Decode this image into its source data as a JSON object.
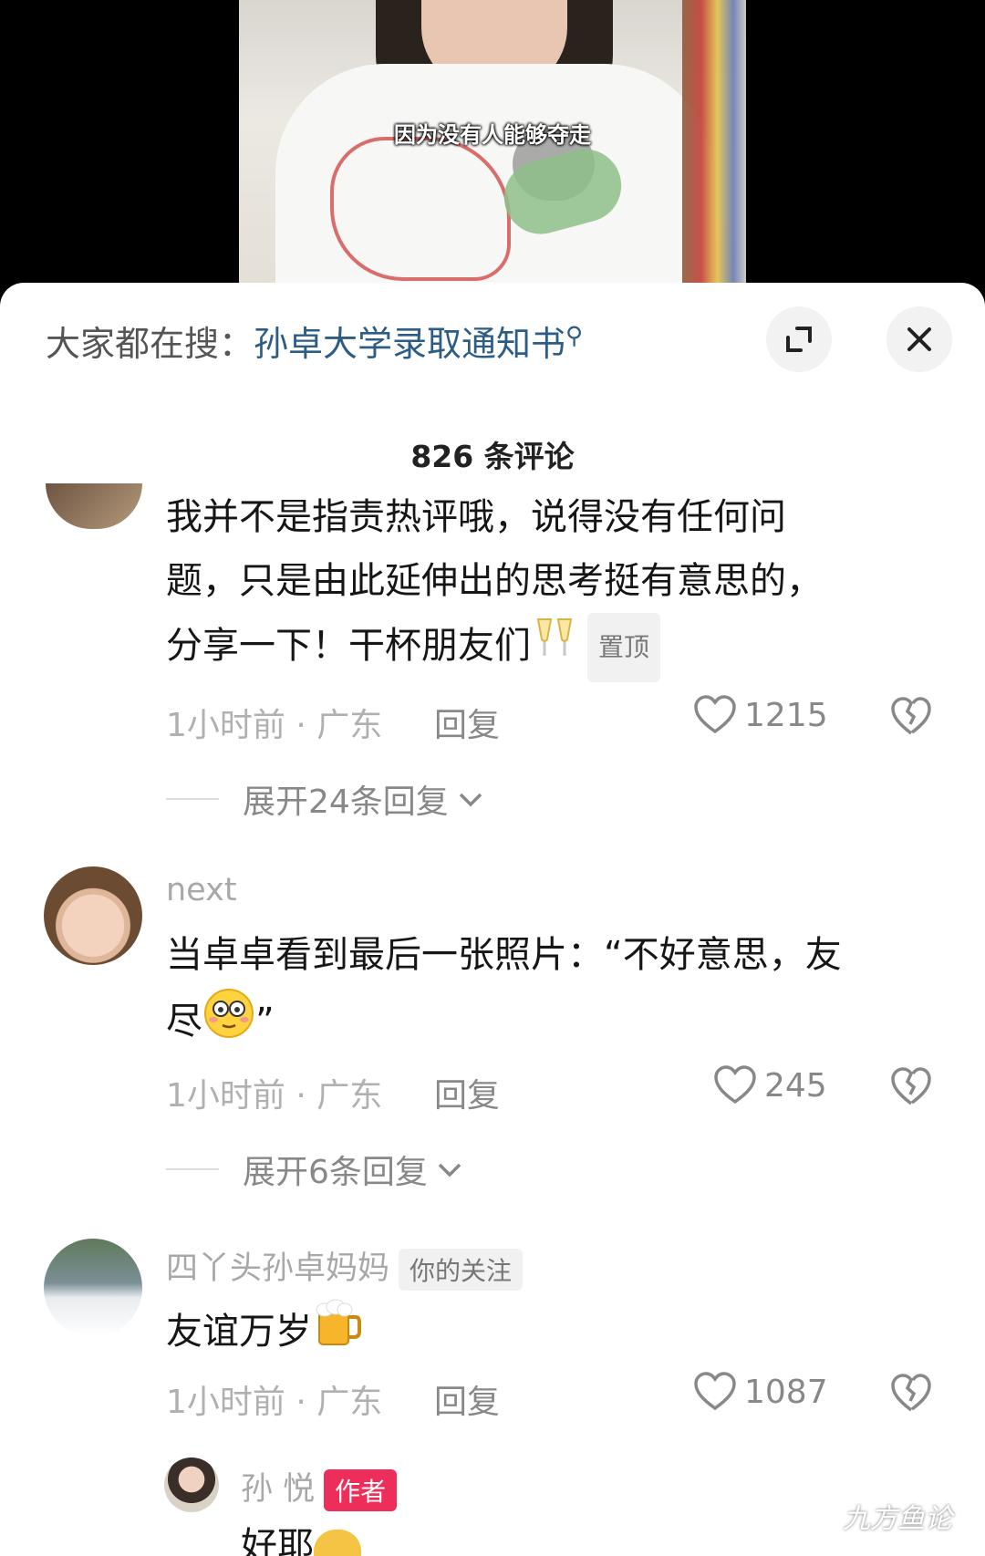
{
  "video": {
    "subtitle": "因为没有人能够夺走"
  },
  "search": {
    "prefix": "大家都在搜：",
    "query": "孙卓大学录取通知书",
    "search_icon": "search-icon"
  },
  "header": {
    "comment_count": "826 条评论",
    "expand_icon": "expand-icon",
    "close_icon": "close-icon"
  },
  "comments": [
    {
      "text_lines": [
        "我并不是指责热评哦，说得没有任何问",
        "题，只是由此延伸出的思考挺有意思的，",
        "分享一下！干杯朋友们"
      ],
      "emoji": "clinking-glasses-emoji",
      "tag": "置顶",
      "time_location": "1小时前 · 广东",
      "reply_label": "回复",
      "likes": "1215",
      "expand_label": "展开24条回复"
    },
    {
      "username": "next",
      "text_lines": [
        "当卓卓看到最后一张照片：“不好意思，友",
        "尽"
      ],
      "line2_tail": "”",
      "emoji": "flushed-face-emoji",
      "time_location": "1小时前 · 广东",
      "reply_label": "回复",
      "likes": "245",
      "expand_label": "展开6条回复"
    },
    {
      "username": "四丫头孙卓妈妈",
      "tag": "你的关注",
      "text": "友谊万岁",
      "emoji": "beer-mug-emoji",
      "time_location": "1小时前 · 广东",
      "reply_label": "回复",
      "likes": "1087"
    }
  ],
  "reply": {
    "username": "孙 悦",
    "tag": "作者",
    "text": "好耶"
  },
  "watermark": "九方鱼论",
  "colors": {
    "link": "#2c5d86",
    "author_tag": "#ee2e5a",
    "sheet_bg": "#ffffff"
  }
}
